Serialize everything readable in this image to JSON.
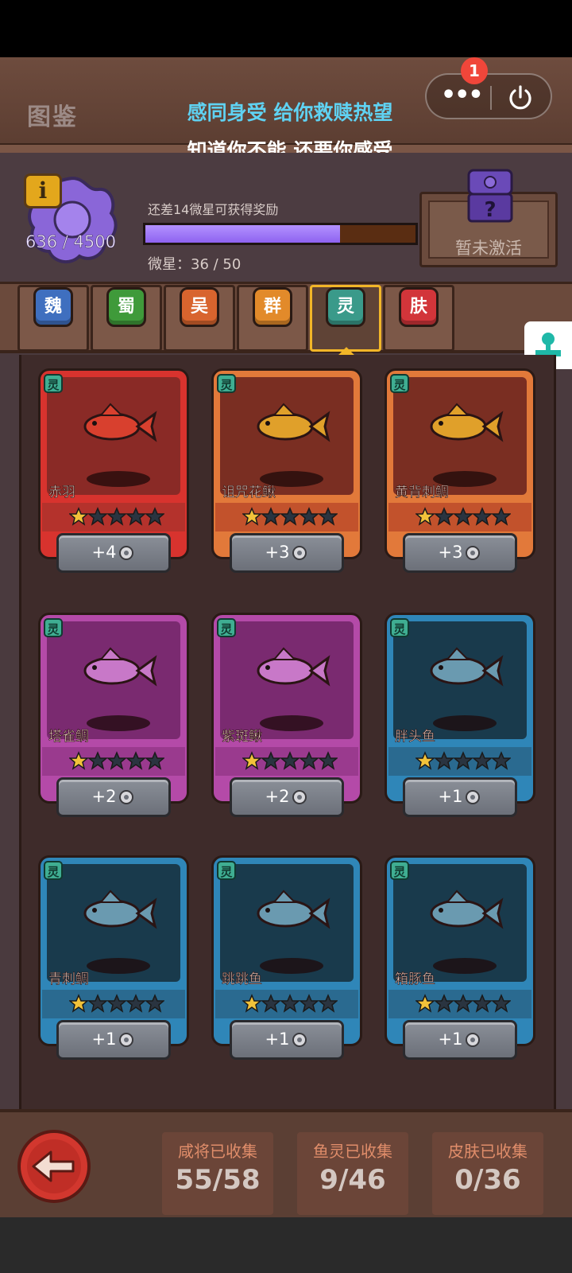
{
  "header": {
    "title": "图鉴",
    "lyric_line1": "感同身受 给你救赎热望",
    "lyric_line2": "知道你不能 还要你感受",
    "notification_count": "1",
    "more_label": "•••"
  },
  "progress": {
    "total": "636 / 4500",
    "need_text": "还差14微星可获得奖励",
    "star_label": "微星：36 / 50",
    "fraction": 0.72,
    "reward_label": "暂未激活"
  },
  "tabs": [
    {
      "label": "魏",
      "color": "#3f6fbf"
    },
    {
      "label": "蜀",
      "color": "#3f9a3a"
    },
    {
      "label": "吴",
      "color": "#d8642e"
    },
    {
      "label": "群",
      "color": "#e28a2a"
    },
    {
      "label": "灵",
      "color": "#3a9a8a"
    },
    {
      "label": "肤",
      "color": "#d2353a"
    }
  ],
  "active_tab": 4,
  "cards": [
    {
      "name": "赤羽",
      "tag": "灵",
      "frag": "+4",
      "stars": 1,
      "theme": "red"
    },
    {
      "name": "诅咒花鳅",
      "tag": "灵",
      "frag": "+3",
      "stars": 1,
      "theme": "orange"
    },
    {
      "name": "黄背刺鲷",
      "tag": "灵",
      "frag": "+3",
      "stars": 1,
      "theme": "orange"
    },
    {
      "name": "塔雀鲷",
      "tag": "灵",
      "frag": "+2",
      "stars": 1,
      "theme": "purple"
    },
    {
      "name": "紫斑鳅",
      "tag": "灵",
      "frag": "+2",
      "stars": 1,
      "theme": "purple"
    },
    {
      "name": "胖头鱼",
      "tag": "灵",
      "frag": "+1",
      "stars": 1,
      "theme": "blue"
    },
    {
      "name": "青刺鲷",
      "tag": "灵",
      "frag": "+1",
      "stars": 1,
      "theme": "blue"
    },
    {
      "name": "跳跳鱼",
      "tag": "灵",
      "frag": "+1",
      "stars": 1,
      "theme": "blue"
    },
    {
      "name": "箱豚鱼",
      "tag": "灵",
      "frag": "+1",
      "stars": 1,
      "theme": "blue"
    }
  ],
  "stats": [
    {
      "label": "咸将已收集",
      "value": "55/58"
    },
    {
      "label": "鱼灵已收集",
      "value": "9/46"
    },
    {
      "label": "皮肤已收集",
      "value": "0/36"
    }
  ],
  "themes": {
    "red": {
      "frame": "#d8332e",
      "art": "#8a2a26",
      "ribbon": "#b4322c"
    },
    "orange": {
      "frame": "#e2793a",
      "art": "#7a2e22",
      "ribbon": "#c2522c"
    },
    "purple": {
      "frame": "#b44aa8",
      "art": "#7a2a70",
      "ribbon": "#9a3a8e"
    },
    "blue": {
      "frame": "#2f86b8",
      "art": "#193a4c",
      "ribbon": "#2a6a90"
    }
  }
}
